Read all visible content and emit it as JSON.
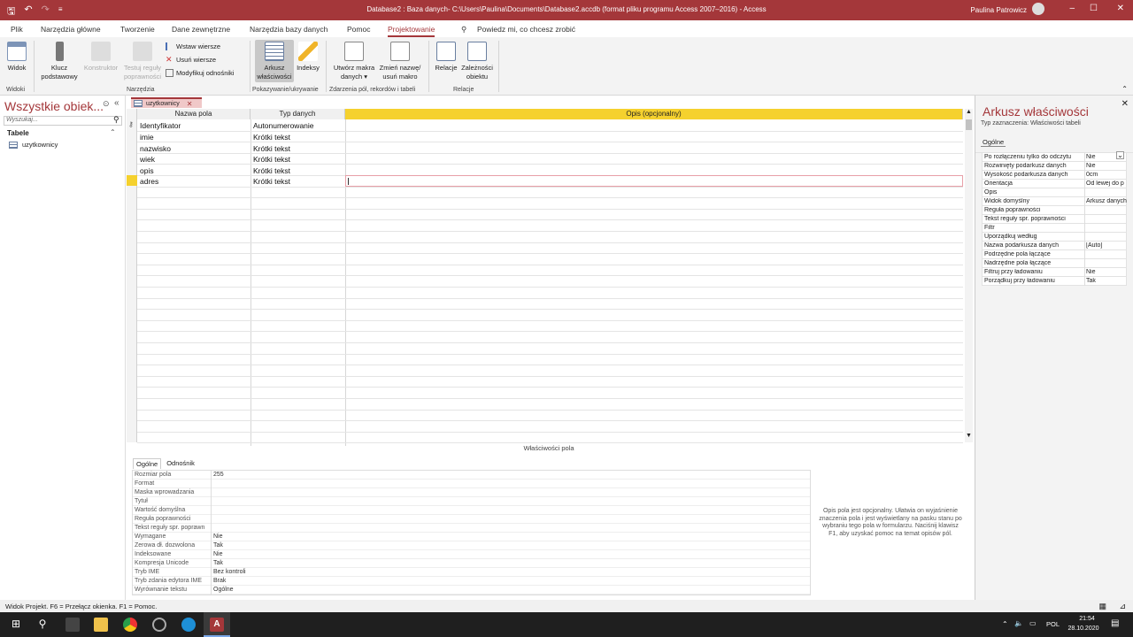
{
  "titlebar": {
    "title": "Database2 : Baza danych- C:\\Users\\Paulina\\Documents\\Database2.accdb (format pliku programu Access 2007–2016) - Access",
    "user": "Paulina Patrowicz",
    "min": "–",
    "max": "☐",
    "close": "✕"
  },
  "tabs": [
    "Plik",
    "Narzędzia główne",
    "Tworzenie",
    "Dane zewnętrzne",
    "Narzędzia bazy danych",
    "Pomoc",
    "Projektowanie"
  ],
  "tellme": "Powiedz mi, co chcesz zrobić",
  "ribbon": {
    "widok": "Widok",
    "klucz1": "Klucz",
    "klucz2": "podstawowy",
    "konstruktor": "Konstruktor",
    "testuj1": "Testuj reguły",
    "testuj2": "poprawności",
    "wstaw": "Wstaw wiersze",
    "usun": "Usuń wiersze",
    "modyfikuj": "Modyfikuj odnośniki",
    "arkusz1": "Arkusz",
    "arkusz2": "właściwości",
    "indeksy": "Indeksy",
    "utworz1": "Utwórz makra",
    "utworz2": "danych ▾",
    "zmien1": "Zmień nazwę/",
    "zmien2": "usuń makro",
    "relacje": "Relacje",
    "zalez1": "Zależności",
    "zalez2": "obiektu",
    "groups": {
      "widoki": "Widoki",
      "narzedzia": "Narzędzia",
      "pokazywanie": "Pokazywanie/ukrywanie",
      "zdarzenia": "Zdarzenia pól, rekordów i tabeli",
      "relacje": "Relacje"
    }
  },
  "nav": {
    "header": "Wszystkie obiek...",
    "search_placeholder": "Wyszukaj...",
    "group": "Tabele",
    "items": [
      "uzytkownicy"
    ]
  },
  "doc_tab": "uzytkownicy",
  "grid": {
    "headers": [
      "Nazwa pola",
      "Typ danych",
      "Opis (opcjonalny)"
    ],
    "rows": [
      {
        "name": "Identyfikator",
        "type": "Autonumerowanie"
      },
      {
        "name": "imie",
        "type": "Krótki tekst"
      },
      {
        "name": "nazwisko",
        "type": "Krótki tekst"
      },
      {
        "name": "wiek",
        "type": "Krótki tekst"
      },
      {
        "name": "opis",
        "type": "Krótki tekst"
      },
      {
        "name": "adres",
        "type": "Krótki tekst"
      }
    ]
  },
  "field_props": {
    "label": "Właściwości pola",
    "tabs": [
      "Ogólne",
      "Odnośnik"
    ],
    "rows": [
      {
        "k": "Rozmiar pola",
        "v": "255"
      },
      {
        "k": "Format",
        "v": ""
      },
      {
        "k": "Maska wprowadzania",
        "v": ""
      },
      {
        "k": "Tytuł",
        "v": ""
      },
      {
        "k": "Wartość domyślna",
        "v": ""
      },
      {
        "k": "Reguła poprawności",
        "v": ""
      },
      {
        "k": "Tekst reguły spr. poprawn",
        "v": ""
      },
      {
        "k": "Wymagane",
        "v": "Nie"
      },
      {
        "k": "Zerowa dł. dozwolona",
        "v": "Tak"
      },
      {
        "k": "Indeksowane",
        "v": "Nie"
      },
      {
        "k": "Kompresja Unicode",
        "v": "Tak"
      },
      {
        "k": "Tryb IME",
        "v": "Bez kontroli"
      },
      {
        "k": "Tryb zdania edytora IME",
        "v": "Brak"
      },
      {
        "k": "Wyrównanie tekstu",
        "v": "Ogólne"
      }
    ],
    "help": "Opis pola jest opcjonalny. Ułatwia on wyjaśnienie znaczenia pola i jest wyświetlany na pasku stanu po wybraniu tego pola w formularzu. Naciśnij klawisz F1, aby uzyskać pomoc na temat opisów pól."
  },
  "prop_sheet": {
    "title": "Arkusz właściwości",
    "type": "Typ zaznaczenia:  Właściwości tabeli",
    "tab": "Ogólne",
    "rows": [
      {
        "k": "Po rozłączeniu tylko do odczytu",
        "v": "Nie"
      },
      {
        "k": "Rozwinięty podarkusz danych",
        "v": "Nie"
      },
      {
        "k": "Wysokość podarkusza danych",
        "v": "0cm"
      },
      {
        "k": "Orientacja",
        "v": "Od lewej do p"
      },
      {
        "k": "Opis",
        "v": ""
      },
      {
        "k": "Widok domyślny",
        "v": "Arkusz danych"
      },
      {
        "k": "Reguła poprawności",
        "v": ""
      },
      {
        "k": "Tekst reguły spr. poprawności",
        "v": ""
      },
      {
        "k": "Filtr",
        "v": ""
      },
      {
        "k": "Uporządkuj według",
        "v": ""
      },
      {
        "k": "Nazwa podarkusza danych",
        "v": "[Auto]"
      },
      {
        "k": "Podrzędne pola łączące",
        "v": ""
      },
      {
        "k": "Nadrzędne pola łączące",
        "v": ""
      },
      {
        "k": "Filtruj przy ładowaniu",
        "v": "Nie"
      },
      {
        "k": "Porządkuj przy ładowaniu",
        "v": "Tak"
      }
    ]
  },
  "status": "Widok Projekt. F6 = Przełącz okienka. F1 = Pomoc.",
  "taskbar": {
    "lang": "POL",
    "time": "21:54",
    "date": "28.10.2020"
  },
  "colors": {
    "accent": "#a4373a",
    "header_yellow": "#f5d12e",
    "taskbar": "#1f1f1f"
  }
}
